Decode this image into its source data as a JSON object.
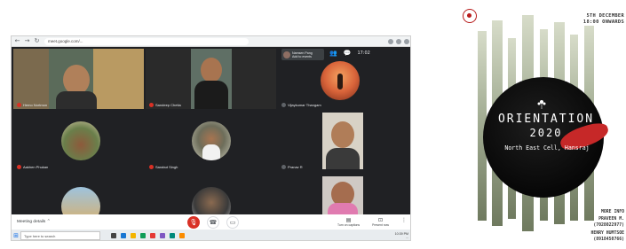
{
  "browser": {
    "url": "meet.google.com/..."
  },
  "participants": [
    {
      "name": "Hemo Nortmon"
    },
    {
      "name": "Sandeep Chetia"
    },
    {
      "name": "Vijaykumar Thangam"
    },
    {
      "name": "Aakhen Phukan"
    },
    {
      "name": "Sarabut Singh"
    },
    {
      "name": "Pranav R"
    }
  ],
  "people_chip": {
    "name": "Namsen Pang",
    "subtitle": "Add to events"
  },
  "clock": "17:02",
  "controls": {
    "meeting_details": "Meeting details ⌃",
    "captions_label": "Turn on captions",
    "present_label": "Present now"
  },
  "taskbar": {
    "search_placeholder": "Type here to search",
    "time": "10:39 PM",
    "date": "..."
  },
  "poster": {
    "date": "5TH DECEMBER",
    "time": "18:00 ONWARDS",
    "title": "ORIENTATION",
    "year": "2020",
    "subtitle": "North East Cell, Hansraj",
    "more_info": "MORE INFO",
    "contact_1_name": "PRAVEEN M.",
    "contact_1_phone": "(7028022977)",
    "contact_2_name": "HENRY HUMTSOE",
    "contact_2_phone": "(8918450766)"
  },
  "colors": {
    "meet_bg": "#202124",
    "tile_bg": "#3c4043",
    "mic_red": "#d93025",
    "poster_red": "#c62828"
  }
}
